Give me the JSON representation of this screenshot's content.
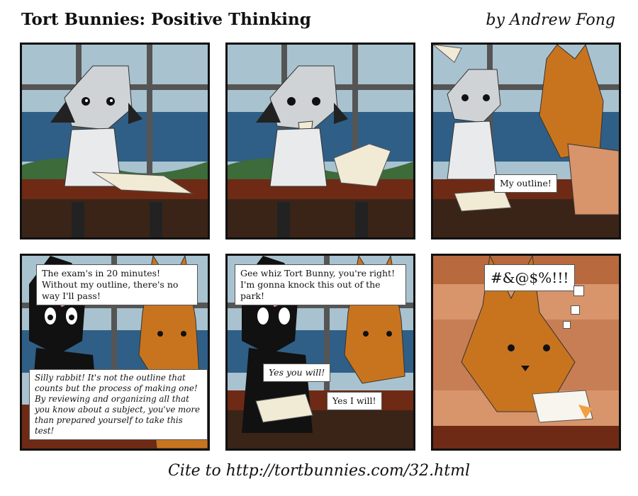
{
  "header": {
    "title": "Tort Bunnies: Positive Thinking",
    "byline": "by Andrew Fong"
  },
  "footer": {
    "cite": "Cite to http://tortbunnies.com/32.html"
  },
  "panels": {
    "p3": {
      "speech_1": "My outline!"
    },
    "p4": {
      "speech_1": "The exam's in 20 minutes! Without my outline, there's no way I'll pass!",
      "speech_2": "Silly rabbit! It's not the outline that counts but the process of making one! By reviewing and organizing all that you know about a subject, you've more than prepared yourself to take this test!"
    },
    "p5": {
      "speech_1": "Gee whiz Tort Bunny, you're right! I'm gonna knock this out of the park!",
      "speech_2": "Yes you will!",
      "speech_3": "Yes I will!"
    },
    "p6": {
      "thought_1": "#&@$%!!!"
    }
  },
  "colors": {
    "sky": "#9fb9c6",
    "sea": "#2f5f86",
    "desk": "#6e2a14",
    "grey_bunny": "#cfd3d6",
    "orange_bunny": "#c8741f",
    "black_bunny": "#111111"
  }
}
